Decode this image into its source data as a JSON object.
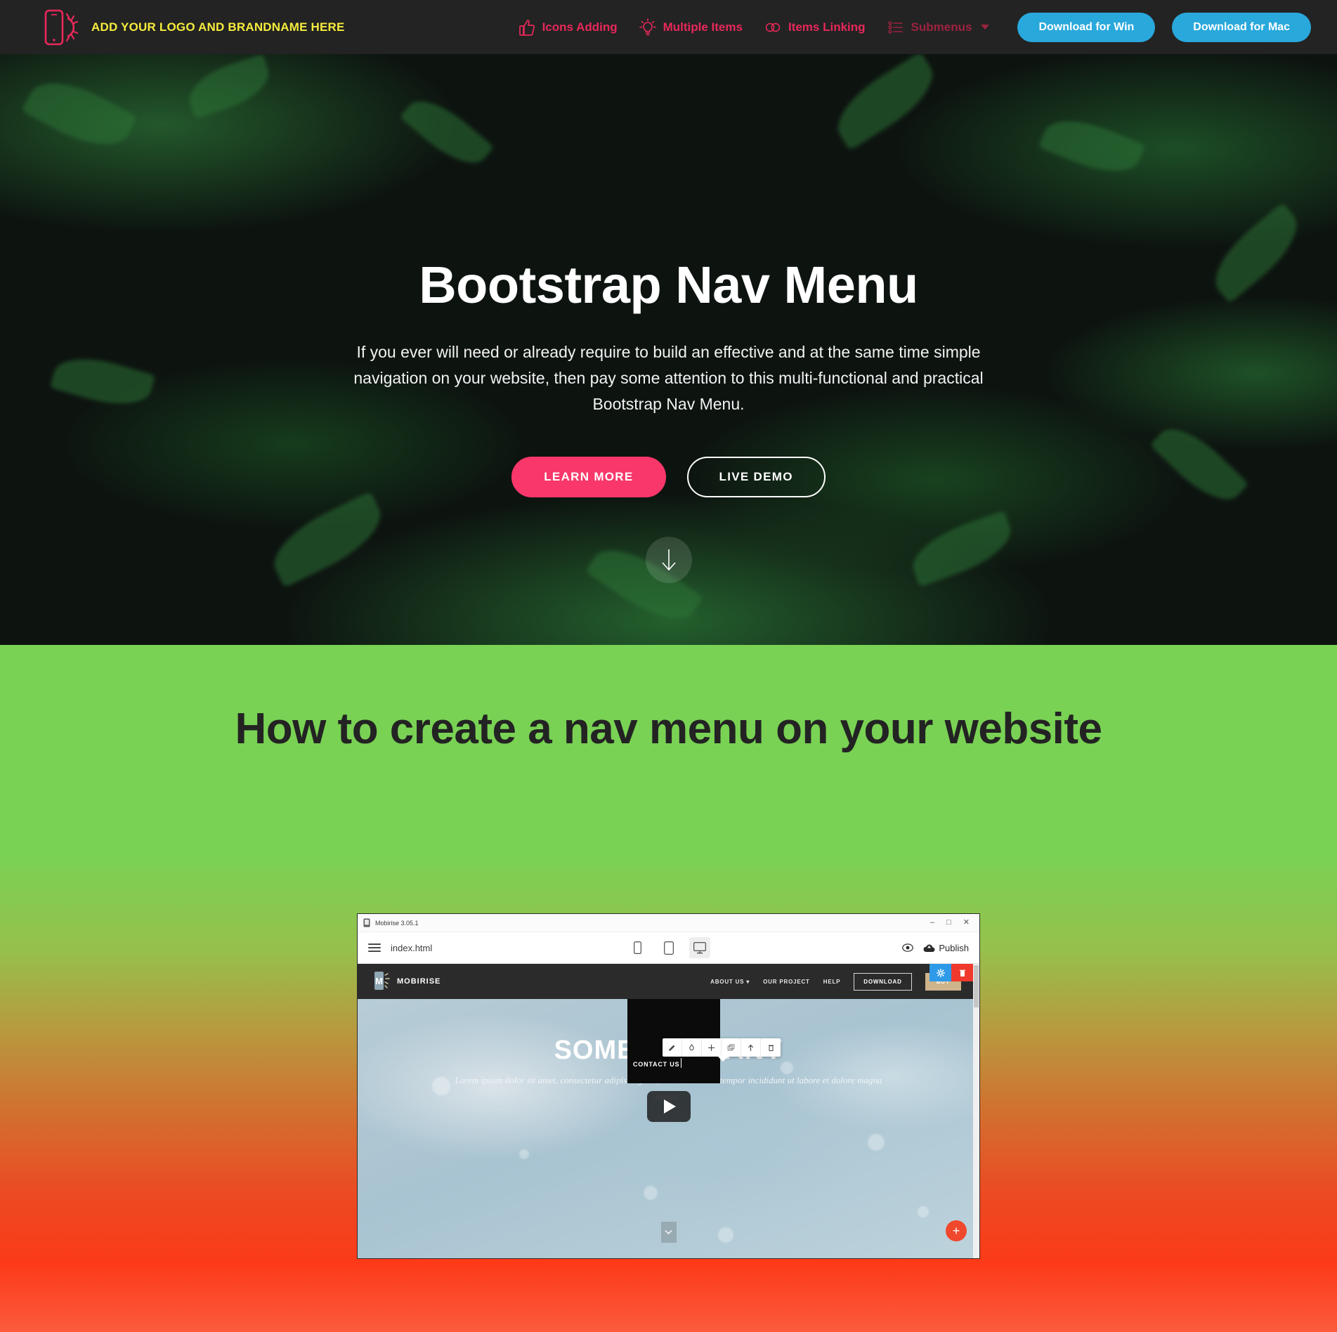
{
  "navbar": {
    "logo_icon": "phone-sun-logo-icon",
    "brand_name": "ADD YOUR LOGO AND BRANDNAME HERE",
    "links": [
      {
        "label": "Icons Adding",
        "icon": "thumbs-up-icon",
        "dim": false
      },
      {
        "label": "Multiple Items",
        "icon": "lightbulb-icon",
        "dim": false
      },
      {
        "label": "Items Linking",
        "icon": "chain-links-icon",
        "dim": false
      },
      {
        "label": "Submenus",
        "icon": "bullet-list-icon",
        "dim": true
      }
    ],
    "buttons": [
      {
        "label": "Download for Win"
      },
      {
        "label": "Download for Mac"
      }
    ],
    "accent_pink": "#e8285a",
    "accent_yellow": "#f5ec3d",
    "accent_blue": "#29a8dc",
    "background": "#232323"
  },
  "hero": {
    "title": "Bootstrap Nav Menu",
    "subtitle": "If you ever will need or already require to build an effective and at the same time simple navigation on your website, then pay some attention to this multi-functional and practical Bootstrap Nav Menu.",
    "primary_button": "LEARN MORE",
    "secondary_button": "LIVE DEMO",
    "scroll_icon": "arrow-down-icon",
    "primary_color": "#f9376a"
  },
  "section": {
    "title": "How to create a nav menu on your website",
    "gradient_start": "#79d254",
    "gradient_end": "#fb5b3e",
    "title_color": "#232323"
  },
  "app_window": {
    "titlebar": {
      "icon": "mobirise-app-icon",
      "title": "Mobirise 3.05.1",
      "minimize": "–",
      "maximize": "□",
      "close": "✕"
    },
    "toolbar": {
      "menu_icon": "hamburger-menu-icon",
      "file_name": "index.html",
      "devices": [
        {
          "icon": "mobile-icon",
          "active": false
        },
        {
          "icon": "tablet-icon",
          "active": false
        },
        {
          "icon": "desktop-icon",
          "active": true
        }
      ],
      "preview_icon": "eye-preview-icon",
      "publish_icon": "cloud-upload-icon",
      "publish_label": "Publish"
    },
    "preview": {
      "nav": {
        "logo_icon": "mobirise-m-logo-icon",
        "brand": "MOBIRISE",
        "items": [
          "ABOUT US",
          "OUR PROJECT",
          "HELP"
        ],
        "about_caret": "▾",
        "download_button": "DOWNLOAD",
        "buy_button": "BUY"
      },
      "corner_buttons": [
        {
          "icon": "gear-icon",
          "color": "#2e9ae8"
        },
        {
          "icon": "trash-icon",
          "color": "#f0382c"
        }
      ],
      "edit_toolbar": [
        "pencil-icon",
        "paint-bucket-icon",
        "move-icon",
        "duplicate-icon",
        "move-up-icon",
        "delete-icon"
      ],
      "contact_label": "CONTACT US",
      "hero_title": "SOME COMPANY",
      "hero_subtitle": "Lorem ipsum dolor sit amet, consectetur adipiscing elit, sed do eiusmod tempor incididunt ut labore et dolore magna aliqua.",
      "scroll_icon": "chevron-down-icon",
      "fab_icon": "plus-icon",
      "fab_label": "+"
    }
  },
  "video": {
    "play_icon": "play-button-icon"
  }
}
